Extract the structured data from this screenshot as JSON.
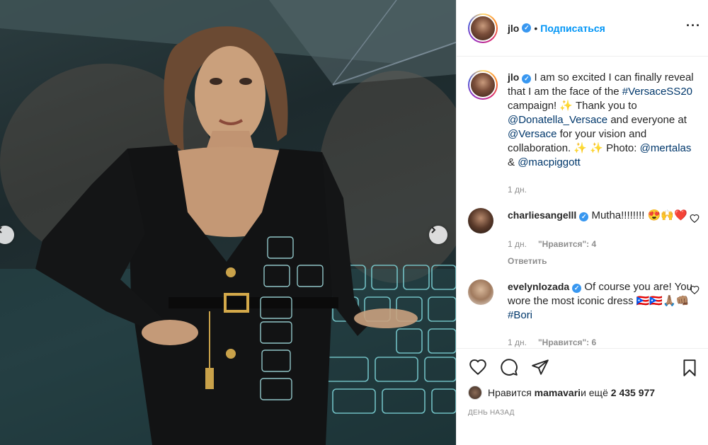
{
  "post": {
    "username": "jlo",
    "follow_label": "Подписаться",
    "separator": "•",
    "more_label": "···"
  },
  "caption": {
    "username": "jlo",
    "text_1": " I am so excited I can finally reveal that I am the face of the ",
    "hashtag": "#VersaceSS20",
    "text_2": " campaign! ✨ Thank you to ",
    "mention_1": "@Donatella_Versace",
    "text_3": " and everyone at ",
    "mention_2": "@Versace",
    "text_4": " for your vision and collaboration. ✨ ✨ Photo: ",
    "mention_3": "@mertalas",
    "text_5": " & ",
    "mention_4": "@macpiggott",
    "time": "1 дн."
  },
  "comments": [
    {
      "username": "charliesangelll",
      "text": " Mutha!!!!!!!! 😍🙌❤️",
      "time": "1 дн.",
      "likes_label": "\"Нравится\": 4",
      "reply_label": "Ответить"
    },
    {
      "username": "evelynlozada",
      "text_1": " Of course you are! You wore the most iconic dress 🇵🇷🇵🇷🙏🏽👊🏽 ",
      "hashtag": "#Bori",
      "time": "1 дн.",
      "likes_label": "\"Нравится\": 6"
    }
  ],
  "likes": {
    "prefix": "Нравится ",
    "user": "mamavari",
    "middle": " и ещё ",
    "count": "2 435 977"
  },
  "time_ago": "ДЕНЬ НАЗАД",
  "icons": {
    "verified": "verified-badge-icon",
    "prev": "chevron-left-icon",
    "next": "chevron-right-icon",
    "like": "heart-icon",
    "comment": "comment-bubble-icon",
    "share": "paper-plane-icon",
    "save": "bookmark-icon"
  },
  "colors": {
    "accent": "#0095f6",
    "verified": "#3897f0",
    "muted": "#8e8e8e"
  }
}
